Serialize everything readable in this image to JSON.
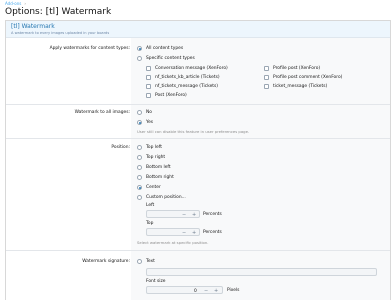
{
  "breadcrumb": {
    "item": "Add-ons",
    "sep": "›"
  },
  "title": "Options: [tl] Watermark",
  "block": {
    "title": "[tl] Watermark",
    "description": "A watermark to every images uploaded in your boards"
  },
  "content_types": {
    "label": "Apply watermarks for content types:",
    "all": "All content types",
    "specific": "Specific content types",
    "items": [
      "Conversation message (XenForo)",
      "Profile post (XenForo)",
      "nf_tickets_kb_article (Tickets)",
      "Profile post comment (XenForo)",
      "nf_tickets_message (Tickets)",
      "ticket_message (Tickets)",
      "Post (XenForo)"
    ]
  },
  "all_images": {
    "label": "Watermark to all images:",
    "no": "No",
    "yes": "Yes",
    "hint": "User still can disable this feature in user preferences page."
  },
  "position": {
    "label": "Position:",
    "options": [
      "Top left",
      "Top right",
      "Bottom left",
      "Bottom right",
      "Center",
      "Custom position..."
    ],
    "selected": "Center",
    "left_label": "Left",
    "top_label": "Top",
    "unit": "Percents",
    "minus": "−",
    "plus": "+",
    "hint": "Select watermark at specific position."
  },
  "signature": {
    "label": "Watermark signature:",
    "text_option": "Text",
    "font_size_label": "Font size",
    "font_size_value": "0",
    "unit": "Pixels",
    "minus": "−",
    "plus": "+"
  }
}
